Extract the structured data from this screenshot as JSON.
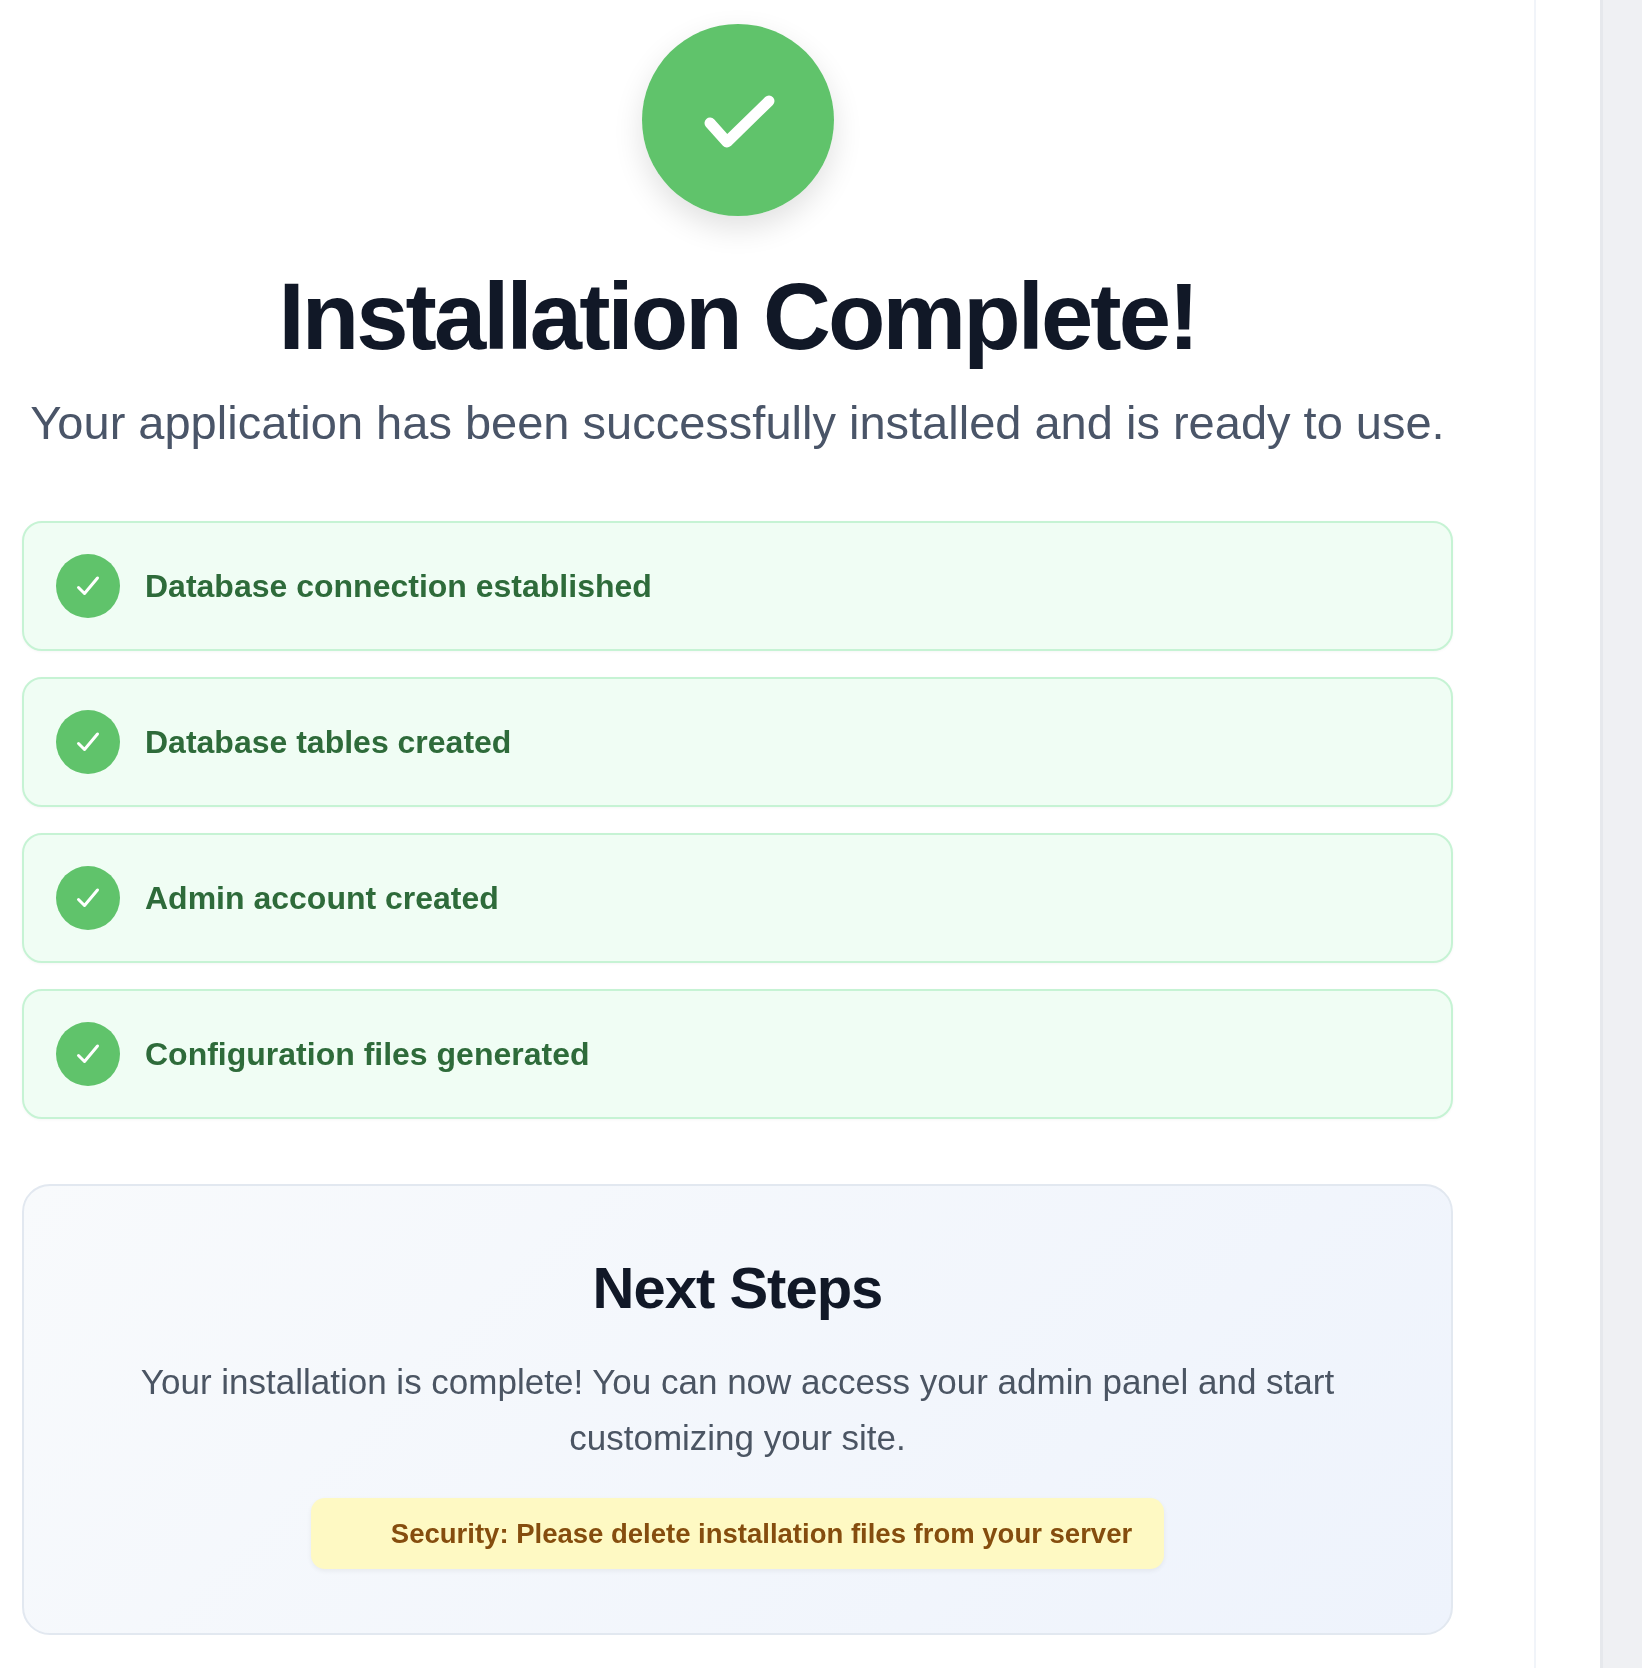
{
  "hero": {
    "title": "Installation Complete!",
    "subtitle": "Your application has been successfully installed and is ready to use."
  },
  "steps": [
    {
      "label": "Database connection established",
      "done": true
    },
    {
      "label": "Database tables created",
      "done": true
    },
    {
      "label": "Admin account created",
      "done": true
    },
    {
      "label": "Configuration files generated",
      "done": true
    }
  ],
  "next_steps": {
    "title": "Next Steps",
    "text": "Your installation is complete! You can now access your admin panel and start customizing your site.",
    "notice": "Security: Please delete installation files from your server"
  }
}
